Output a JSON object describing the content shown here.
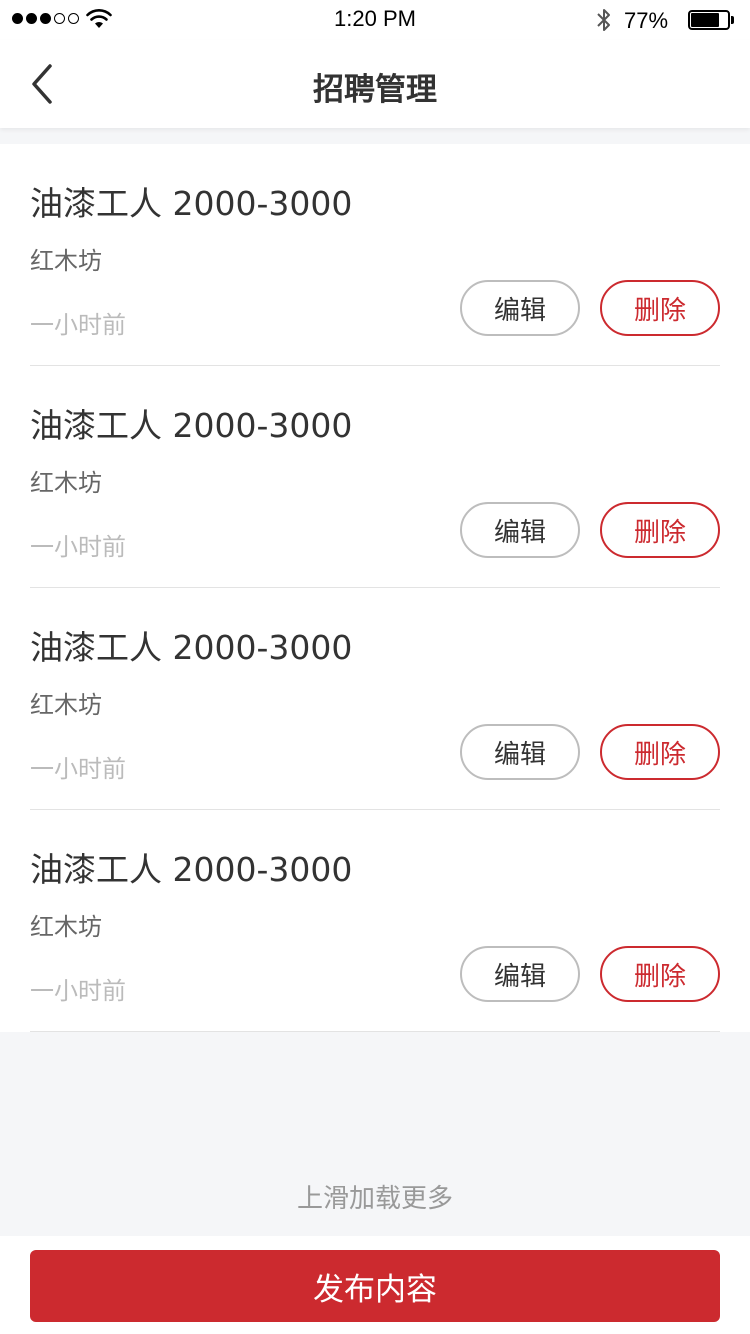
{
  "status_bar": {
    "time": "1:20 PM",
    "battery_percent_text": "77%",
    "battery_level": 0.77,
    "signal_bars_filled": 3,
    "signal_bars_total": 5
  },
  "nav": {
    "title": "招聘管理",
    "back_icon": "chevron-left-icon"
  },
  "jobs": [
    {
      "title": "油漆工人 2000-3000",
      "company": "红木坊",
      "time": "一小时前",
      "edit_label": "编辑",
      "delete_label": "删除"
    },
    {
      "title": "油漆工人 2000-3000",
      "company": "红木坊",
      "time": "一小时前",
      "edit_label": "编辑",
      "delete_label": "删除"
    },
    {
      "title": "油漆工人 2000-3000",
      "company": "红木坊",
      "time": "一小时前",
      "edit_label": "编辑",
      "delete_label": "删除"
    },
    {
      "title": "油漆工人 2000-3000",
      "company": "红木坊",
      "time": "一小时前",
      "edit_label": "编辑",
      "delete_label": "删除"
    }
  ],
  "load_more": "上滑加载更多",
  "publish_label": "发布内容",
  "colors": {
    "accent": "#cc2a2f",
    "background": "#f5f6f8",
    "text_primary": "#333333",
    "text_muted": "#bbbbbb"
  }
}
